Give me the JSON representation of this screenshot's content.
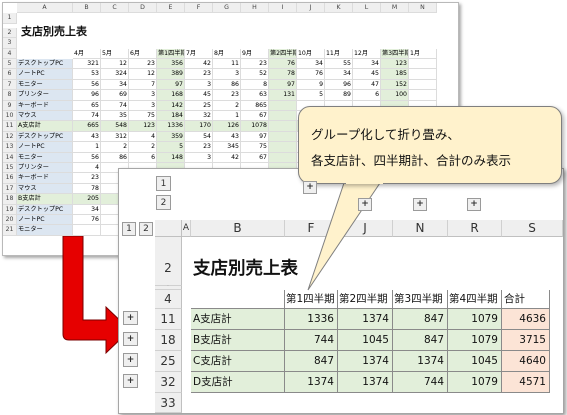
{
  "small_sheet": {
    "col_headers": [
      "A",
      "B",
      "C",
      "D",
      "E",
      "F",
      "G",
      "H",
      "I",
      "J",
      "K",
      "L",
      "M",
      "N"
    ],
    "row_numbers": [
      "1",
      "2",
      "3",
      "4",
      "5",
      "6",
      "7",
      "8",
      "9",
      "10",
      "11",
      "12",
      "13",
      "14",
      "15",
      "16",
      "17",
      "18",
      "19",
      "20",
      "21"
    ],
    "title": "支店別売上表",
    "month_headers": [
      "4月",
      "5月",
      "6月",
      "第1四半期",
      "7月",
      "8月",
      "9月",
      "第2四半期",
      "10月",
      "11月",
      "12月",
      "第3四半期",
      "1月"
    ],
    "rows": [
      {
        "name": "デスクトップPC",
        "vals": [
          "321",
          "12",
          "23",
          "356",
          "42",
          "11",
          "23",
          "76",
          "34",
          "55",
          "34",
          "123",
          ""
        ]
      },
      {
        "name": "ノートPC",
        "vals": [
          "53",
          "324",
          "12",
          "389",
          "23",
          "3",
          "52",
          "78",
          "76",
          "34",
          "45",
          "185",
          ""
        ]
      },
      {
        "name": "モニター",
        "vals": [
          "56",
          "34",
          "7",
          "97",
          "3",
          "86",
          "8",
          "97",
          "9",
          "96",
          "47",
          "152",
          ""
        ]
      },
      {
        "name": "プリンター",
        "vals": [
          "96",
          "69",
          "3",
          "168",
          "45",
          "23",
          "63",
          "131",
          "5",
          "89",
          "6",
          "100",
          ""
        ]
      },
      {
        "name": "キーボード",
        "vals": [
          "65",
          "74",
          "3",
          "142",
          "25",
          "2",
          "865",
          "",
          "",
          "",
          "",
          "",
          ""
        ]
      },
      {
        "name": "マウス",
        "vals": [
          "74",
          "35",
          "75",
          "184",
          "32",
          "1",
          "67",
          "",
          "",
          "",
          "",
          "",
          ""
        ]
      },
      {
        "name": "A支店計",
        "vals": [
          "665",
          "548",
          "123",
          "1336",
          "170",
          "126",
          "1078",
          "",
          "",
          "",
          "",
          "",
          ""
        ]
      },
      {
        "name": "デスクトップPC",
        "vals": [
          "43",
          "312",
          "4",
          "359",
          "54",
          "43",
          "97",
          "",
          "",
          "",
          "",
          "",
          ""
        ]
      },
      {
        "name": "ノートPC",
        "vals": [
          "1",
          "2",
          "2",
          "5",
          "23",
          "345",
          "75",
          "",
          "",
          "",
          "",
          "",
          ""
        ]
      },
      {
        "name": "モニター",
        "vals": [
          "56",
          "86",
          "6",
          "148",
          "3",
          "42",
          "67",
          "",
          "",
          "",
          "",
          "",
          ""
        ]
      },
      {
        "name": "プリンター",
        "vals": [
          "4",
          "",
          "",
          "",
          "",
          "",
          "",
          "",
          "",
          "",
          "",
          "",
          ""
        ]
      },
      {
        "name": "キーボード",
        "vals": [
          "23",
          "",
          "",
          "",
          "",
          "",
          "",
          "",
          "",
          "",
          "",
          "",
          ""
        ]
      },
      {
        "name": "マウス",
        "vals": [
          "78",
          "",
          "",
          "",
          "",
          "",
          "",
          "",
          "",
          "",
          "",
          "",
          ""
        ]
      },
      {
        "name": "B支店計",
        "vals": [
          "205",
          "",
          "",
          "",
          "",
          "",
          "",
          "",
          "",
          "",
          "",
          "",
          ""
        ]
      },
      {
        "name": "デスクトップPC",
        "vals": [
          "34",
          "",
          "",
          "",
          "",
          "",
          "",
          "",
          "",
          "",
          "",
          "",
          ""
        ]
      },
      {
        "name": "ノートPC",
        "vals": [
          "76",
          "",
          "",
          "",
          "",
          "",
          "",
          "",
          "",
          "",
          "",
          "",
          ""
        ]
      },
      {
        "name": "モニター",
        "vals": [
          "",
          "",
          "",
          "",
          "",
          "",
          "",
          "",
          "",
          "",
          "",
          "",
          ""
        ]
      }
    ]
  },
  "callout": {
    "line1": "グループ化して折り畳み、",
    "line2": "各支店計、四半期計、合計のみ表示"
  },
  "main_sheet": {
    "outline_levels": [
      "1",
      "2"
    ],
    "col_headers": [
      "A",
      "B",
      "F",
      "J",
      "N",
      "R",
      "S"
    ],
    "row_numbers": [
      "2",
      "3",
      "4",
      "11",
      "18",
      "25",
      "32",
      "33"
    ],
    "title": "支店別売上表",
    "headers": [
      "第1四半期",
      "第2四半期",
      "第3四半期",
      "第4四半期",
      "合計"
    ],
    "rows": [
      {
        "label": "A支店計",
        "values": [
          "1336",
          "1374",
          "847",
          "1079",
          "4636"
        ]
      },
      {
        "label": "B支店計",
        "values": [
          "744",
          "1045",
          "847",
          "1079",
          "3715"
        ]
      },
      {
        "label": "C支店計",
        "values": [
          "847",
          "1374",
          "1374",
          "1045",
          "4640"
        ]
      },
      {
        "label": "D支店計",
        "values": [
          "1374",
          "1374",
          "744",
          "1079",
          "4571"
        ]
      }
    ],
    "expand_symbol": "+"
  },
  "colors": {
    "quarter_fill": "#e2efda",
    "total_fill": "#fce4d6",
    "arrow": "#e60000",
    "callout_fill": "#fff2cc"
  }
}
